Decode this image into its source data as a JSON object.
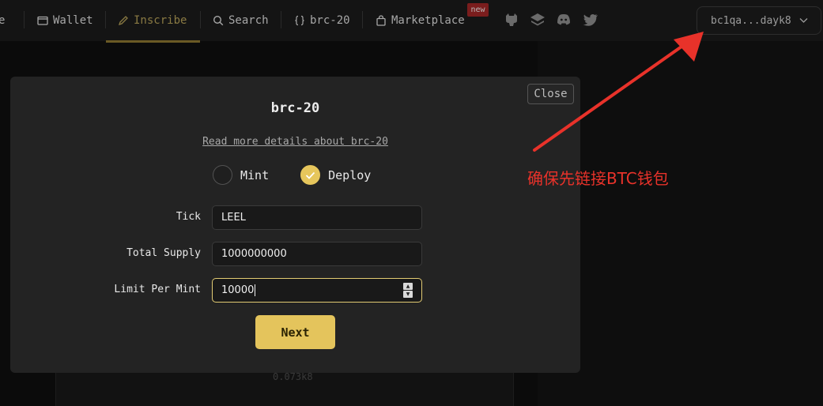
{
  "nav": {
    "items": [
      {
        "label": "e",
        "icon": "home-icon"
      },
      {
        "label": "Wallet",
        "icon": "wallet-icon"
      },
      {
        "label": "Inscribe",
        "icon": "pencil-icon"
      },
      {
        "label": "Search",
        "icon": "search-icon"
      },
      {
        "label": "brc-20",
        "icon": "braces-icon"
      },
      {
        "label": "Marketplace",
        "icon": "bag-icon"
      }
    ],
    "new_badge": "new",
    "active_color": "#8a7a43",
    "socials": [
      "github-icon",
      "layers-icon",
      "discord-icon",
      "twitter-icon"
    ]
  },
  "wallet": {
    "address": "bc1qa...dayk8"
  },
  "background": {
    "amount": "0.073k8"
  },
  "modal": {
    "title": "brc-20",
    "read_more": "Read more details about brc-20",
    "close_label": "Close",
    "radio": {
      "mint": "Mint",
      "deploy": "Deploy",
      "selected": "Deploy"
    },
    "fields": {
      "tick": {
        "label": "Tick",
        "value": "LEEL"
      },
      "total_supply": {
        "label": "Total Supply",
        "value": "1000000000"
      },
      "limit_per_mint": {
        "label": "Limit Per Mint",
        "value": "10000"
      }
    },
    "next_label": "Next",
    "accent": "#e4c45c"
  },
  "annotation": {
    "text": "确保先链接BTC钱包",
    "color": "#e8322a"
  }
}
